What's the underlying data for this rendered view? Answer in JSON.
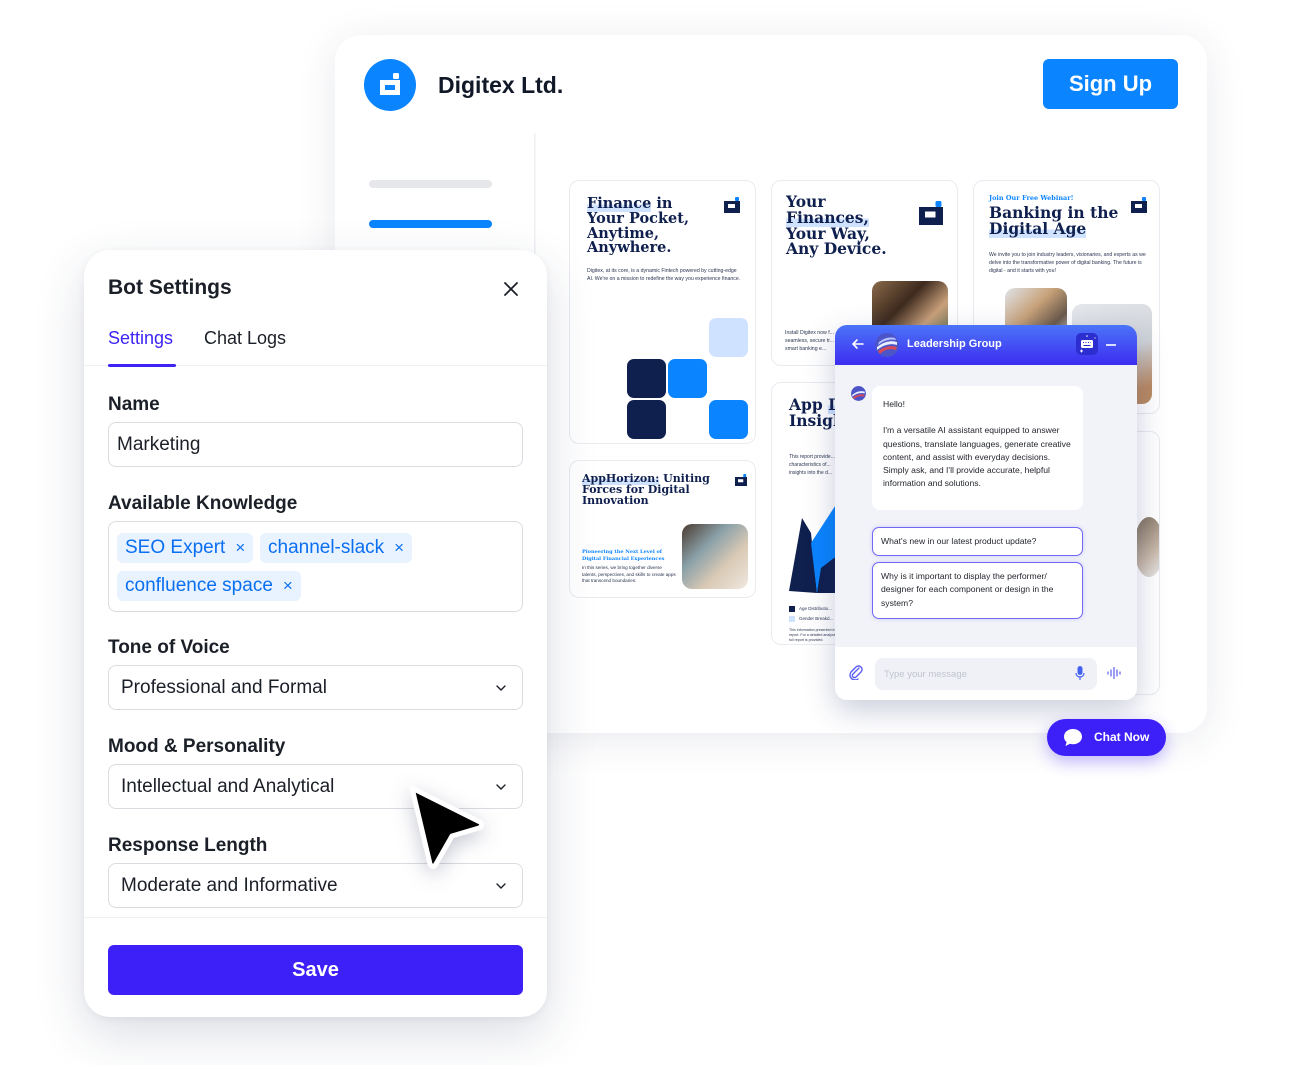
{
  "site": {
    "brand_name": "Digitex Ltd.",
    "signup_label": "Sign Up",
    "colors": {
      "brand_blue": "#0a84ff",
      "navy": "#0f1f4e",
      "light_blue": "#cfe2ff"
    }
  },
  "cards": [
    {
      "title_hl": "Finance",
      "title_rest": " in Your Pocket, Anytime, Anywhere.",
      "body": "Digitex, at its core, is a dynamic Fintech powered by cutting-edge AI. We're on a mission to redefine the way you experience finance."
    },
    {
      "title_pre": "Your ",
      "title_hl": "Finances,",
      "title_rest": " Your Way, Any Device.",
      "body": "Install Digitex now f... seamless, secure tr... and smart banking e..."
    },
    {
      "kicker": "Join Our Free Webinar!",
      "title_pre": "Banking in the ",
      "title_hl": "Digital Age",
      "body": "We invite you to join industry leaders, visionaries, and experts as we delve into the transformative power of digital banking. The future is digital - and it starts with you!"
    },
    {
      "title_hl": "AppHorizon:",
      "title_rest": " Uniting Forces for Digital Innovation",
      "kicker": "Pioneering the Next Level of Digital Financial Experiences",
      "body": "In this series, we bring together diverse talents, perspectives, and skills to create apps that transcend boundaries."
    },
    {
      "title_pre": "App ",
      "title_hl": "Demog",
      "title_rest": " Insigh",
      "body": "This report provide... characteristics of... insights into the d...",
      "legend": [
        "Age Distributio...",
        "Gender Breakd..."
      ],
      "footnote": "This information presented in... report. For a detailed analysis... the full report is provided."
    }
  ],
  "bot_settings": {
    "title": "Bot Settings",
    "tabs": [
      {
        "label": "Settings",
        "active": true
      },
      {
        "label": "Chat Logs",
        "active": false
      }
    ],
    "name_label": "Name",
    "name_value": "Marketing",
    "knowledge_label": "Available Knowledge",
    "knowledge_tags": [
      "SEO Expert",
      "channel-slack",
      "confluence space"
    ],
    "tone_label": "Tone of Voice",
    "tone_value": "Professional and Formal",
    "mood_label": "Mood & Personality",
    "mood_value": "Intellectual and Analytical",
    "length_label": "Response Length",
    "length_value": "Moderate and Informative",
    "save_label": "Save",
    "remove_symbol": "×",
    "accent": "#3d1ff7"
  },
  "chat": {
    "title": "Leadership Group",
    "greeting": "Hello!",
    "intro": "I'm a versatile AI assistant equipped to answer questions, translate languages, generate creative content, and assist with everyday decisions. Simply ask, and I'll provide accurate, helpful information and solutions.",
    "suggestions": [
      "What's new in our latest product update?",
      "Why is it important to display the performer/ designer for each component or design in the system?"
    ],
    "input_placeholder": "Type your message",
    "chat_now_label": "Chat Now"
  }
}
